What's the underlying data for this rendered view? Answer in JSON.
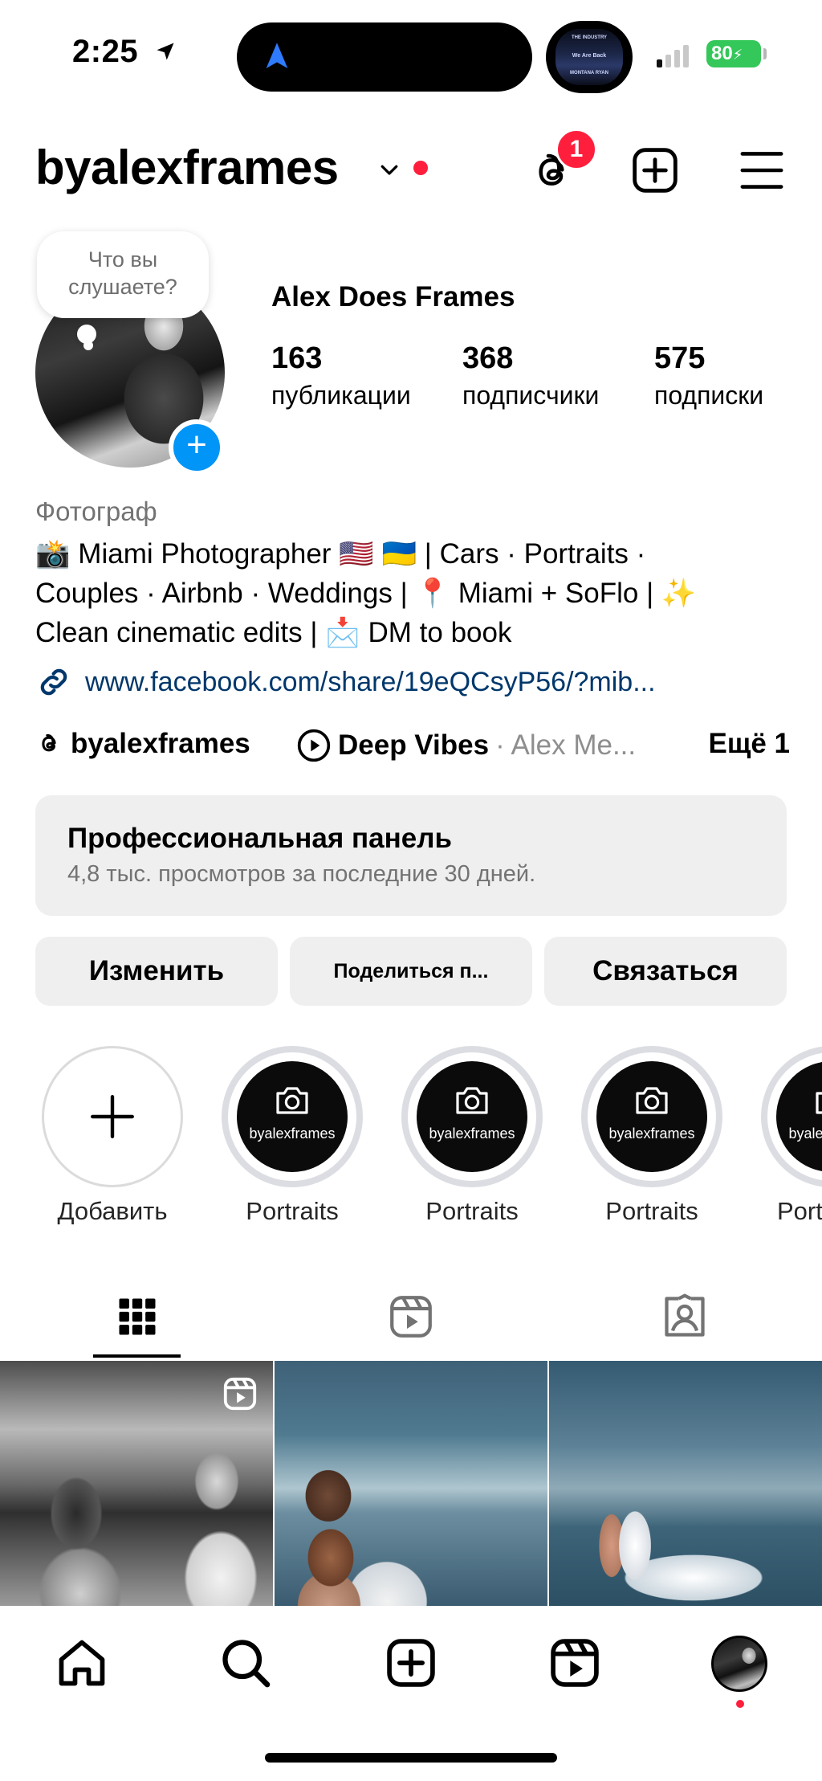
{
  "status_bar": {
    "time": "2:25",
    "battery": "80",
    "island_art_text": [
      "THE INDUSTRY",
      "We Are Back",
      "MONTANA RYAN"
    ]
  },
  "header": {
    "username": "byalexframes",
    "threads_badge": "1"
  },
  "profile": {
    "note": "Что вы слушаете?",
    "display_name": "Alex Does Frames",
    "stats": [
      {
        "value": "163",
        "label": "публикации"
      },
      {
        "value": "368",
        "label": "подписчики"
      },
      {
        "value": "575",
        "label": "подписки"
      }
    ],
    "category": "Фотограф",
    "bio_lines": [
      "📸 Miami Photographer 🇺🇸 🇺🇦 | Cars · Portraits ·",
      "Couples · Airbnb · Weddings | 📍 Miami + SoFlo | ✨",
      "Clean cinematic edits | 📩 DM to book"
    ],
    "link": "www.facebook.com/share/19eQCsyP56/?mib..."
  },
  "threads_row": {
    "threads_handle": "byalexframes",
    "song": "Deep Vibes",
    "artist": "· Alex Me...",
    "more": "Ещё 1"
  },
  "dashboard": {
    "title": "Профессиональная панель",
    "subtitle": "4,8 тыс. просмотров за последние 30 дней."
  },
  "actions": {
    "edit": "Изменить",
    "share": "Поделиться п...",
    "contact": "Связаться"
  },
  "highlights": {
    "add_label": "Добавить",
    "inner_text": "byalexframes",
    "items": [
      {
        "label": "Portraits"
      },
      {
        "label": "Portraits"
      },
      {
        "label": "Portraits"
      },
      {
        "label": "Portr"
      }
    ]
  },
  "colors": {
    "accent_blue": "#0095f6",
    "notification_red": "#ff1f3d",
    "link_blue": "#00376b",
    "battery_green": "#34c759"
  },
  "icons": {
    "header": [
      "chevron-down-icon",
      "threads-icon",
      "create-plus-icon",
      "menu-icon"
    ],
    "tabs": [
      "grid-icon",
      "reels-icon",
      "tagged-icon"
    ],
    "nav": [
      "home-icon",
      "search-icon",
      "create-icon",
      "reels-icon",
      "profile-avatar"
    ]
  }
}
